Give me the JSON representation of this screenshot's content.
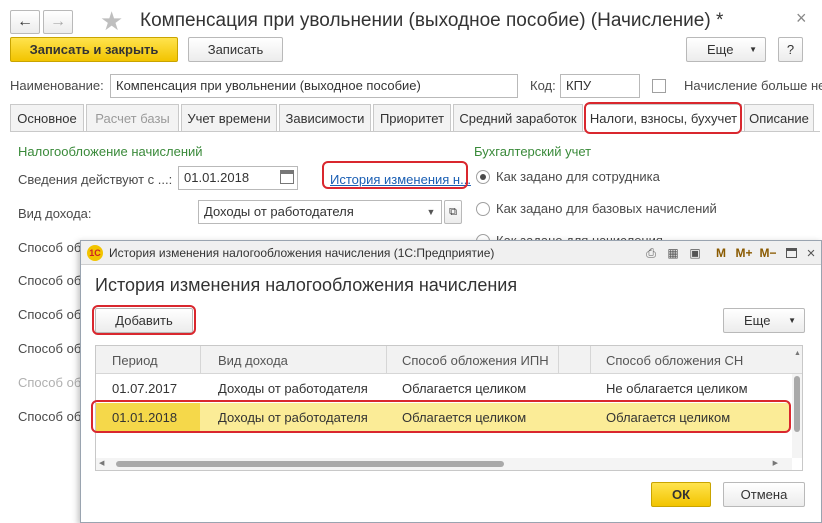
{
  "window": {
    "title": "Компенсация при увольнении (выходное пособие) (Начисление) *",
    "nav_back": "←",
    "nav_forward": "→",
    "star": "★",
    "close": "×"
  },
  "toolbar": {
    "save_close": "Записать и закрыть",
    "save": "Записать",
    "more": "Еще",
    "help": "?"
  },
  "fields": {
    "name_label": "Наименование:",
    "name_value": "Компенсация при увольнении (выходное пособие)",
    "code_label": "Код:",
    "code_value": "КПУ",
    "more_charge_label": "Начисление больше не"
  },
  "tabs": [
    {
      "label": "Основное",
      "state": "normal"
    },
    {
      "label": "Расчет базы",
      "state": "disabled"
    },
    {
      "label": "Учет времени",
      "state": "normal"
    },
    {
      "label": "Зависимости",
      "state": "normal"
    },
    {
      "label": "Приоритет",
      "state": "normal"
    },
    {
      "label": "Средний заработок",
      "state": "normal"
    },
    {
      "label": "Налоги, взносы, бухучет",
      "state": "active"
    },
    {
      "label": "Описание",
      "state": "normal"
    }
  ],
  "taxation": {
    "header": "Налогообложение начислений",
    "valid_from_label": "Сведения действуют с ...:",
    "valid_from_value": "01.01.2018",
    "history_link": "История изменения н...",
    "income_type_label": "Вид дохода:",
    "income_type_value": "Доходы от работодателя",
    "partial_labels": [
      "Способ об",
      "Способ об",
      "Способ об",
      "Способ об",
      "Способ об",
      "Способ об"
    ]
  },
  "accounting": {
    "header": "Бухгалтерский учет",
    "options": [
      "Как задано для сотрудника",
      "Как задано для базовых начислений",
      "Как задано для начисления"
    ]
  },
  "modal": {
    "window_title": "История изменения налогообложения начисления (1С:Предприятие)",
    "heading": "История изменения налогообложения начисления",
    "add_button": "Добавить",
    "more_button": "Еще",
    "toolbar_icons": [
      "M",
      "M+",
      "M−"
    ],
    "columns": [
      "Период",
      "Вид дохода",
      "Способ обложения ИПН",
      "Способ обложения СН"
    ],
    "rows": [
      {
        "period": "01.07.2017",
        "income": "Доходы от работодателя",
        "ipn": "Облагается целиком",
        "sn": "Не облагается целиком",
        "selected": false
      },
      {
        "period": "01.01.2018",
        "income": "Доходы от работодателя",
        "ipn": "Облагается целиком",
        "sn": "Облагается целиком",
        "selected": true
      }
    ],
    "ok": "ОК",
    "cancel": "Отмена"
  },
  "colors": {
    "accent_yellow": "#f2c400",
    "highlight_red": "#d9272e",
    "header_green": "#3a8a3a",
    "link_blue": "#1a5fb4",
    "selected_row": "#fbec97"
  }
}
